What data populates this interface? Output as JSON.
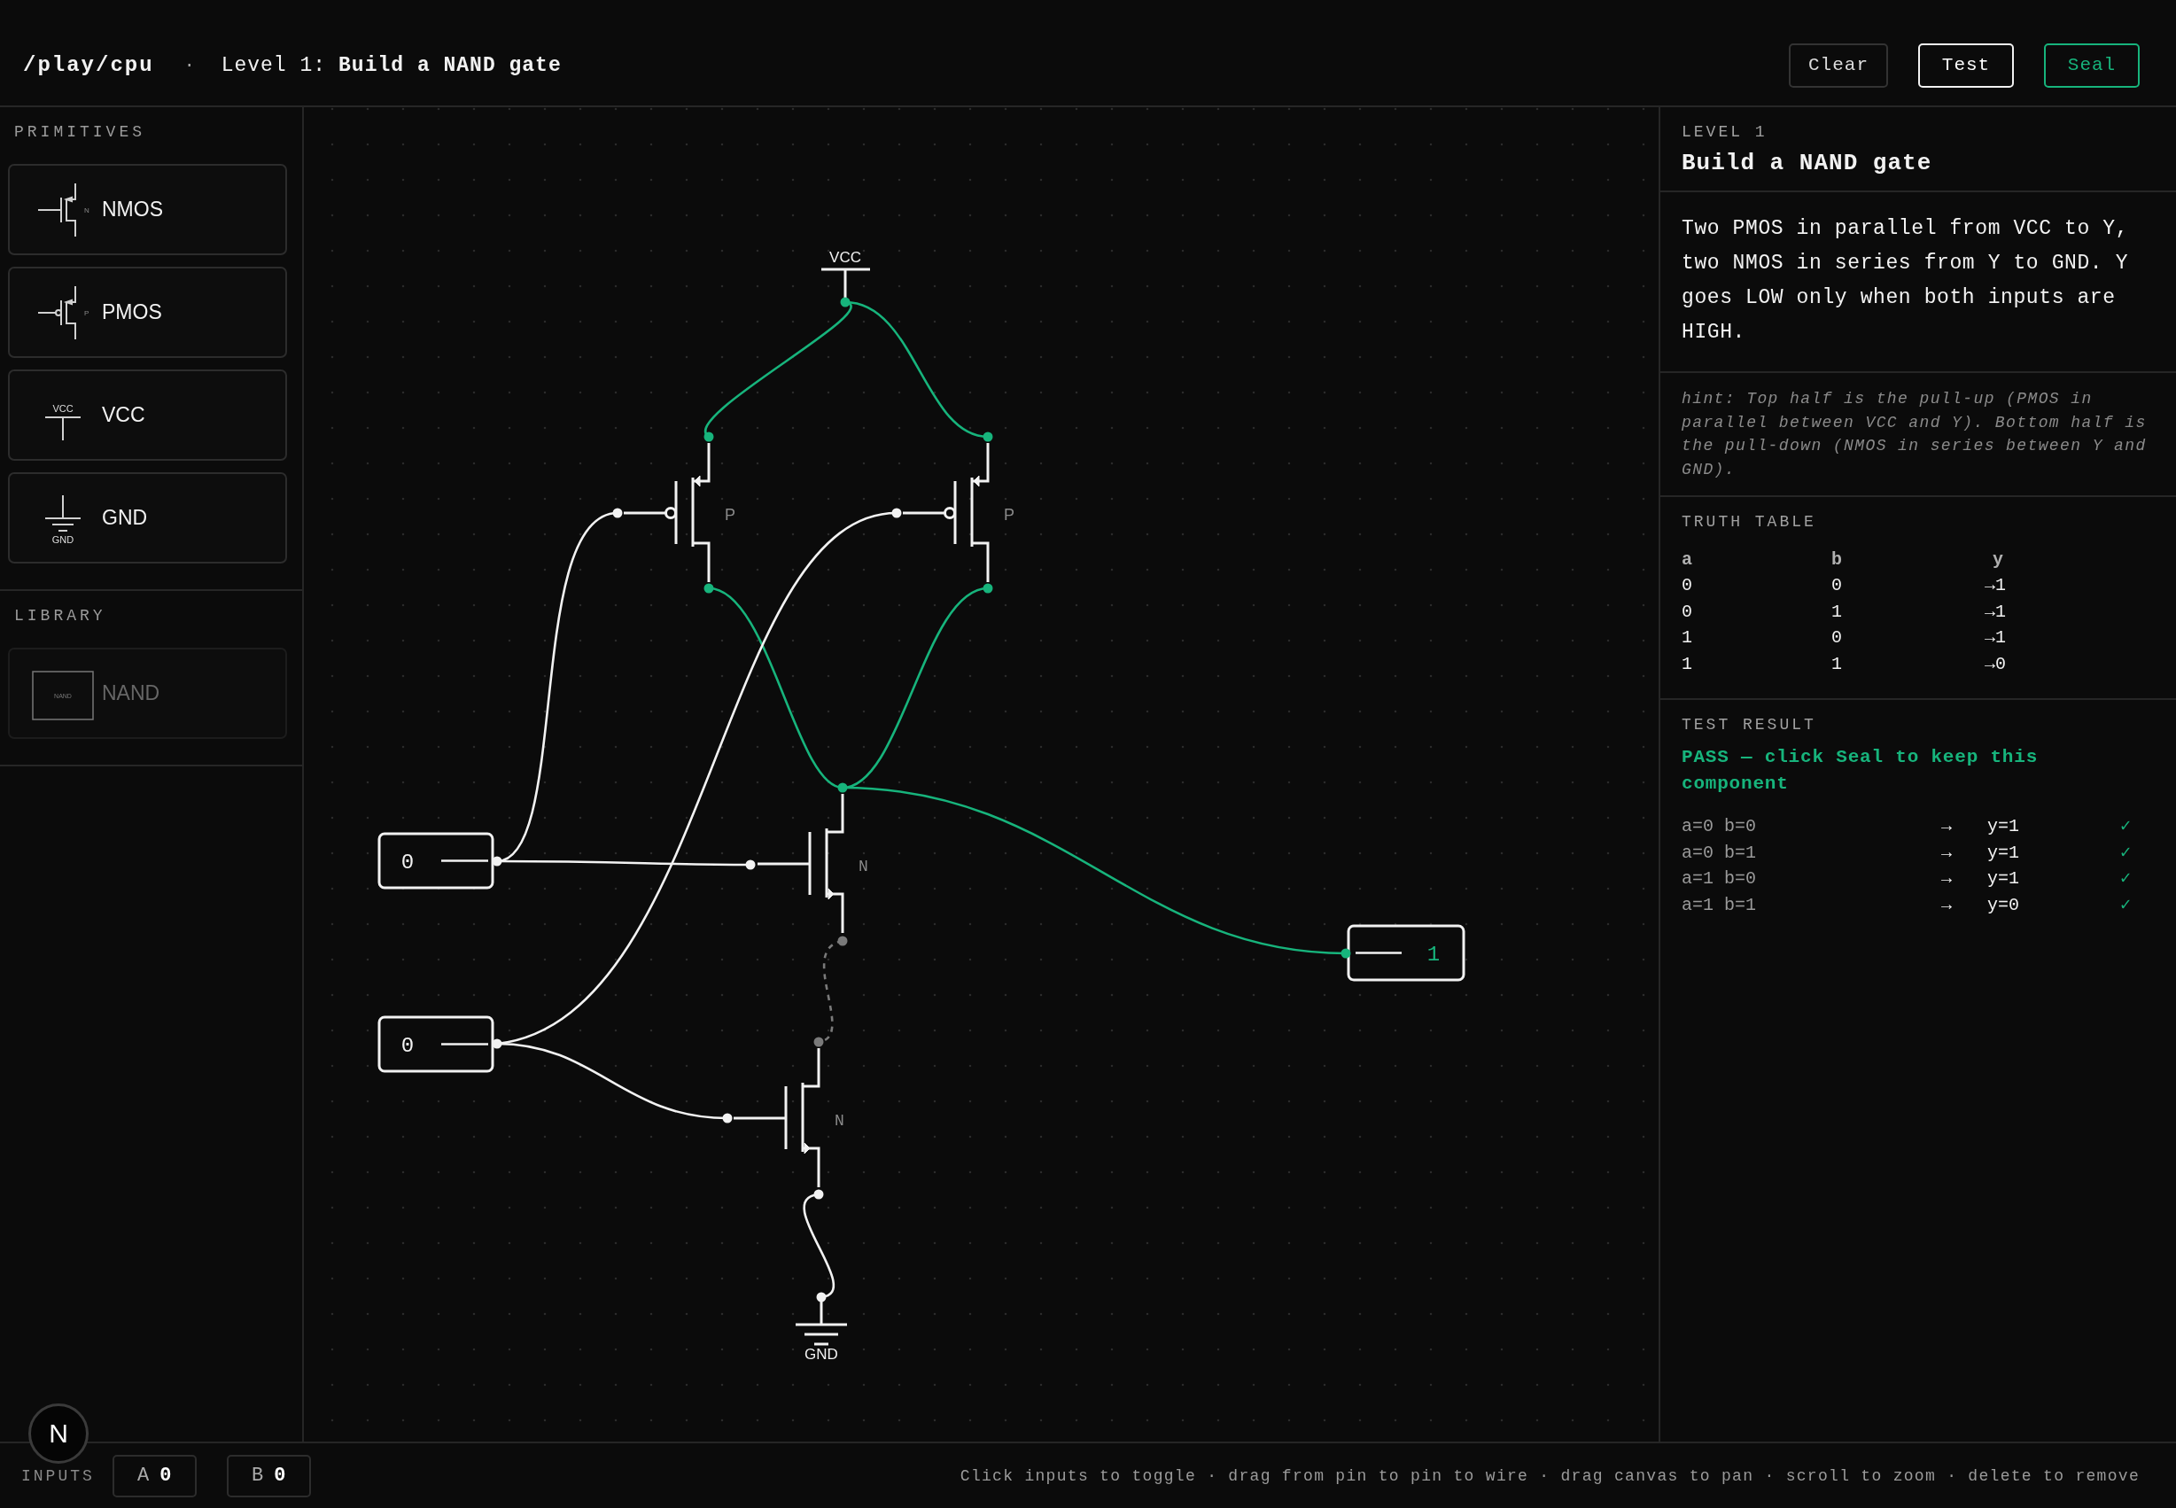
{
  "header": {
    "path": "/play/cpu",
    "separator": "·",
    "level_prefix": "Level 1:",
    "level_title": "Build a NAND gate",
    "buttons": [
      {
        "label": "Clear",
        "kind": "plain"
      },
      {
        "label": "Test",
        "kind": "strong"
      },
      {
        "label": "Seal",
        "kind": "accent"
      }
    ]
  },
  "sidebar": {
    "sections": [
      {
        "title": "PRIMITIVES",
        "items": [
          {
            "label": "NMOS",
            "kind": "nmos",
            "icon_text": "N",
            "disabled": false
          },
          {
            "label": "PMOS",
            "kind": "pmos",
            "icon_text": "P",
            "disabled": false
          },
          {
            "label": "VCC",
            "kind": "vcc",
            "icon_text": "VCC",
            "disabled": false
          },
          {
            "label": "GND",
            "kind": "gnd",
            "icon_text": "GND",
            "disabled": false
          }
        ]
      },
      {
        "title": "LIBRARY",
        "items": [
          {
            "label": "NAND",
            "kind": "chip",
            "icon_text": "NAND",
            "disabled": true
          }
        ]
      }
    ]
  },
  "canvas": {
    "supply": {
      "label": "VCC"
    },
    "ground": {
      "label": "GND"
    },
    "transistors": [
      {
        "kind": "pmos",
        "label": "P"
      },
      {
        "kind": "pmos",
        "label": "P"
      },
      {
        "kind": "nmos",
        "label": "N"
      },
      {
        "kind": "nmos",
        "label": "N"
      }
    ],
    "inputs": [
      {
        "value": "0"
      },
      {
        "value": "0"
      }
    ],
    "output": {
      "value": "1",
      "high": true
    },
    "wires": [
      {
        "powered": true,
        "connected": true
      },
      {
        "powered": true,
        "connected": true
      },
      {
        "powered": true,
        "connected": true
      },
      {
        "powered": true,
        "connected": true
      },
      {
        "powered": true,
        "connected": true
      },
      {
        "powered": false,
        "connected": true
      },
      {
        "powered": false,
        "connected": true
      },
      {
        "powered": false,
        "connected": true
      },
      {
        "powered": false,
        "connected": true
      },
      {
        "powered": false,
        "connected": false
      },
      {
        "powered": false,
        "connected": true
      }
    ]
  },
  "panel": {
    "level": "LEVEL 1",
    "title": "Build a NAND gate",
    "description": "Two PMOS in parallel from VCC to Y, two NMOS in series from Y to GND. Y goes LOW only when both inputs are HIGH.",
    "hint": "hint: Top half is the pull-up (PMOS in parallel between VCC and Y). Bottom half is the pull-down (NMOS in series between Y and GND).",
    "truth_table": {
      "title": "TRUTH TABLE",
      "columns": [
        "a",
        "b",
        "y"
      ],
      "rows": [
        [
          "0",
          "0",
          "→1"
        ],
        [
          "0",
          "1",
          "→1"
        ],
        [
          "1",
          "0",
          "→1"
        ],
        [
          "1",
          "1",
          "→0"
        ]
      ]
    },
    "test_result": {
      "title": "TEST RESULT",
      "status": "PASS — click Seal to keep this component",
      "passed": true,
      "rows": [
        {
          "inputs": "a=0 b=0",
          "arrow": "→",
          "output": "y=1",
          "mark": "✓",
          "pass": true
        },
        {
          "inputs": "a=0 b=1",
          "arrow": "→",
          "output": "y=1",
          "mark": "✓",
          "pass": true
        },
        {
          "inputs": "a=1 b=0",
          "arrow": "→",
          "output": "y=1",
          "mark": "✓",
          "pass": true
        },
        {
          "inputs": "a=1 b=1",
          "arrow": "→",
          "output": "y=0",
          "mark": "✓",
          "pass": true
        }
      ]
    }
  },
  "footer": {
    "label": "INPUTS",
    "inputs": [
      {
        "name": "A",
        "value": "0"
      },
      {
        "name": "B",
        "value": "0"
      }
    ],
    "help": "Click inputs to toggle · drag from pin to pin to wire · drag canvas to pan · scroll to zoom · delete to remove"
  },
  "badge": {
    "letter": "N"
  }
}
